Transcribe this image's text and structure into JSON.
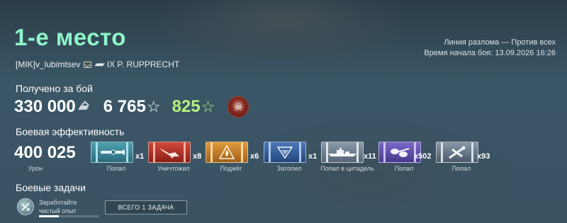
{
  "header": {
    "title": "1-е место",
    "player_name": "[MIK]v_lubimtsev",
    "ship_name": "IX P. RUPPRECHT",
    "battle_type": "Линия разлома — Против всех",
    "battle_start": "Время начала боя: 13.09.2026 16:26"
  },
  "earned": {
    "label": "Получено за бой",
    "credits": "330 000",
    "experience": "6 765",
    "free_experience": "825",
    "icons": {
      "credits": "credits-icon",
      "experience": "star-icon",
      "free_experience": "star-icon-green",
      "achievement": "skull-achievement-icon"
    },
    "colors": {
      "free_experience": "#b6f07e"
    }
  },
  "efficiency": {
    "label": "Боевая эффективность",
    "damage_value": "400 025",
    "damage_caption": "Урон",
    "ribbons": [
      {
        "icon": "torpedo-hit-icon",
        "count": "x1",
        "caption": "Попал"
      },
      {
        "icon": "destroyed-icon",
        "count": "x8",
        "caption": "Уничтожил"
      },
      {
        "icon": "fire-icon",
        "count": "x6",
        "caption": "Поджёг"
      },
      {
        "icon": "flooding-icon",
        "count": "x1",
        "caption": "Затопил"
      },
      {
        "icon": "citadel-hit-icon",
        "count": "x11",
        "caption": "Попал в цитадель"
      },
      {
        "icon": "main-battery-hit-icon",
        "count": "x502",
        "caption": "Попал"
      },
      {
        "icon": "secondary-battery-hit-icon",
        "count": "x93",
        "caption": "Попал"
      }
    ]
  },
  "tasks": {
    "label": "Боевые задачи",
    "task_text": "Заработайте чистый опыт",
    "task_progress": 0.33,
    "all_tasks_button": "ВСЕГО 1 ЗАДАЧА"
  }
}
